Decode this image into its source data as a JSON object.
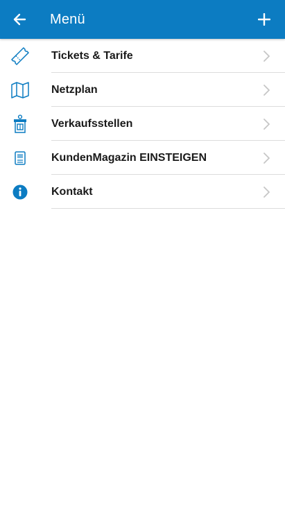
{
  "header": {
    "title": "Menü",
    "back_icon": "arrow-left-icon",
    "add_icon": "plus-icon",
    "background_color": "#0c7cc2"
  },
  "menu": {
    "items": [
      {
        "label": "Tickets & Tarife",
        "icon": "ticket-icon"
      },
      {
        "label": "Netzplan",
        "icon": "map-icon"
      },
      {
        "label": "Verkaufsstellen",
        "icon": "sales-kiosk-icon"
      },
      {
        "label": "KundenMagazin EINSTEIGEN",
        "icon": "magazine-icon"
      },
      {
        "label": "Kontakt",
        "icon": "info-icon"
      }
    ],
    "accent_color": "#0c7cc2"
  }
}
